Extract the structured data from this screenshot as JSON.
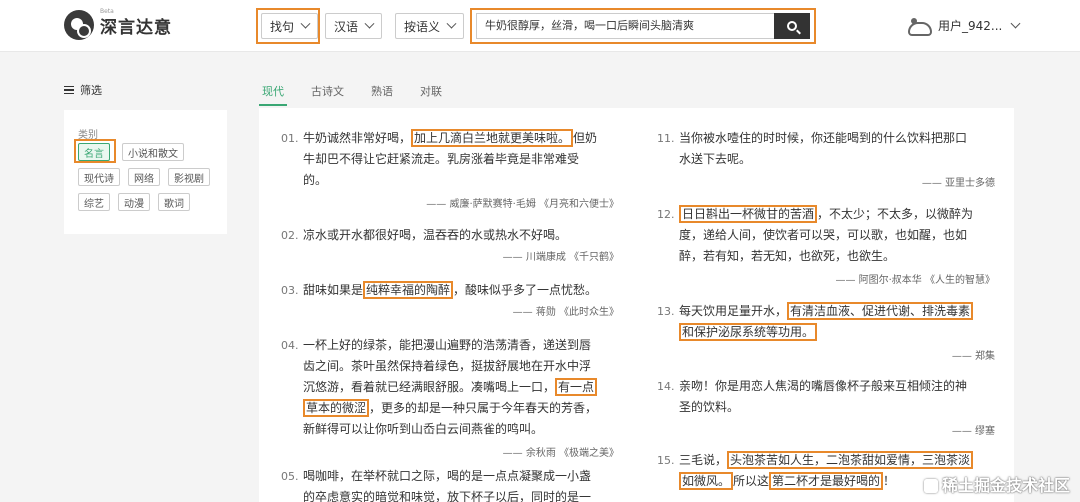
{
  "app": {
    "logo_text": "深言达意",
    "beta": "Beta"
  },
  "header": {
    "mode_select": "找句",
    "lang_select": "汉语",
    "match_select": "按语义",
    "search_value": "牛奶很醇厚，丝滑，喝一口后瞬间头脑清爽",
    "user_name": "用户_942..."
  },
  "sidebar": {
    "filter_title": "筛选",
    "category_label": "类别",
    "tags": [
      "名言",
      "小说和散文",
      "现代诗",
      "网络",
      "影视剧",
      "综艺",
      "动漫",
      "歌词"
    ]
  },
  "tabs": [
    "现代",
    "古诗文",
    "熟语",
    "对联"
  ],
  "results": [
    {
      "num": "01.",
      "lines": [
        [
          "牛奶诚然非常好喝，",
          "加上几滴白兰地就更美味啦。",
          "但奶"
        ],
        [
          "牛却巴不得让它赶紧流走。乳房涨着毕竟是非常难受"
        ],
        [
          "的。"
        ]
      ],
      "source": "—— 威廉·萨默赛特·毛姆 《月亮和六便士》"
    },
    {
      "num": "02.",
      "lines": [
        [
          "凉水或开水都很好喝，温吞吞的水或热水不好喝。"
        ]
      ],
      "source": "—— 川端康成 《千只鹤》"
    },
    {
      "num": "03.",
      "lines": [
        [
          "甜味如果是",
          "纯粹幸福的陶醉",
          "，酸味似乎多了一点忧愁。"
        ]
      ],
      "source": "—— 蒋勋 《此时众生》"
    },
    {
      "num": "04.",
      "lines": [
        [
          "一杯上好的绿茶，能把漫山遍野的浩荡清香，递送到唇"
        ],
        [
          "齿之间。茶叶虽然保持着绿色，挺拔舒展地在开水中浮"
        ],
        [
          "沉悠游，看着就已经满眼舒服。凑嘴喝上一口，",
          "有一点"
        ],
        [
          "",
          "草本的微涩",
          "，更多的却是一种只属于今年春天的芳香，"
        ],
        [
          "新鲜得可以让你听到山岙白云间燕雀的鸣叫。"
        ]
      ],
      "source": "—— 余秋雨 《极端之美》"
    },
    {
      "num": "05.",
      "lines": [
        [
          "喝咖啡，在举杯就口之际，喝的是一点点凝聚成一小盏"
        ],
        [
          "的卒虑意实的暗觉和味觉，放下杯子以后，同时的是一"
        ]
      ],
      "source": ""
    },
    {
      "num": "11.",
      "lines": [
        [
          "当你被水噎住的时时候，你还能喝到的什么饮料把那口"
        ],
        [
          "水送下去呢。"
        ]
      ],
      "source": "—— 亚里士多德"
    },
    {
      "num": "12.",
      "lines": [
        [
          "",
          "日日斟出一杯微甘的苦酒",
          "，不太少；不太多，以微醉为"
        ],
        [
          "度，递给人间，使饮者可以哭，可以歌，也如醒，也如"
        ],
        [
          "醉，若有知，若无知，也欲死，也欲生。"
        ]
      ],
      "source": "—— 阿图尔·叔本华 《人生的智慧》"
    },
    {
      "num": "13.",
      "lines": [
        [
          "每天饮用足量开水，",
          "有清洁血液、促进代谢、排洗毒素"
        ],
        [
          "",
          "和保护泌尿系统等功用。"
        ]
      ],
      "source": "—— 郑集"
    },
    {
      "num": "14.",
      "lines": [
        [
          "亲吻！你是用恋人焦渴的嘴唇像杯子般来互相倾注的神"
        ],
        [
          "圣的饮料。"
        ]
      ],
      "source": "—— 缪塞"
    },
    {
      "num": "15.",
      "lines": [
        [
          "三毛说，",
          "头泡茶苦如人生，二泡茶甜如爱情，三泡茶淡"
        ],
        [
          "",
          "如微风。",
          "所以这",
          "第二杯才是最好喝的",
          "！"
        ]
      ],
      "source": ""
    }
  ],
  "watermark": "稀土掘金技术社区",
  "colors": {
    "accent": "#3aa774",
    "highlight": "#e8892b"
  }
}
